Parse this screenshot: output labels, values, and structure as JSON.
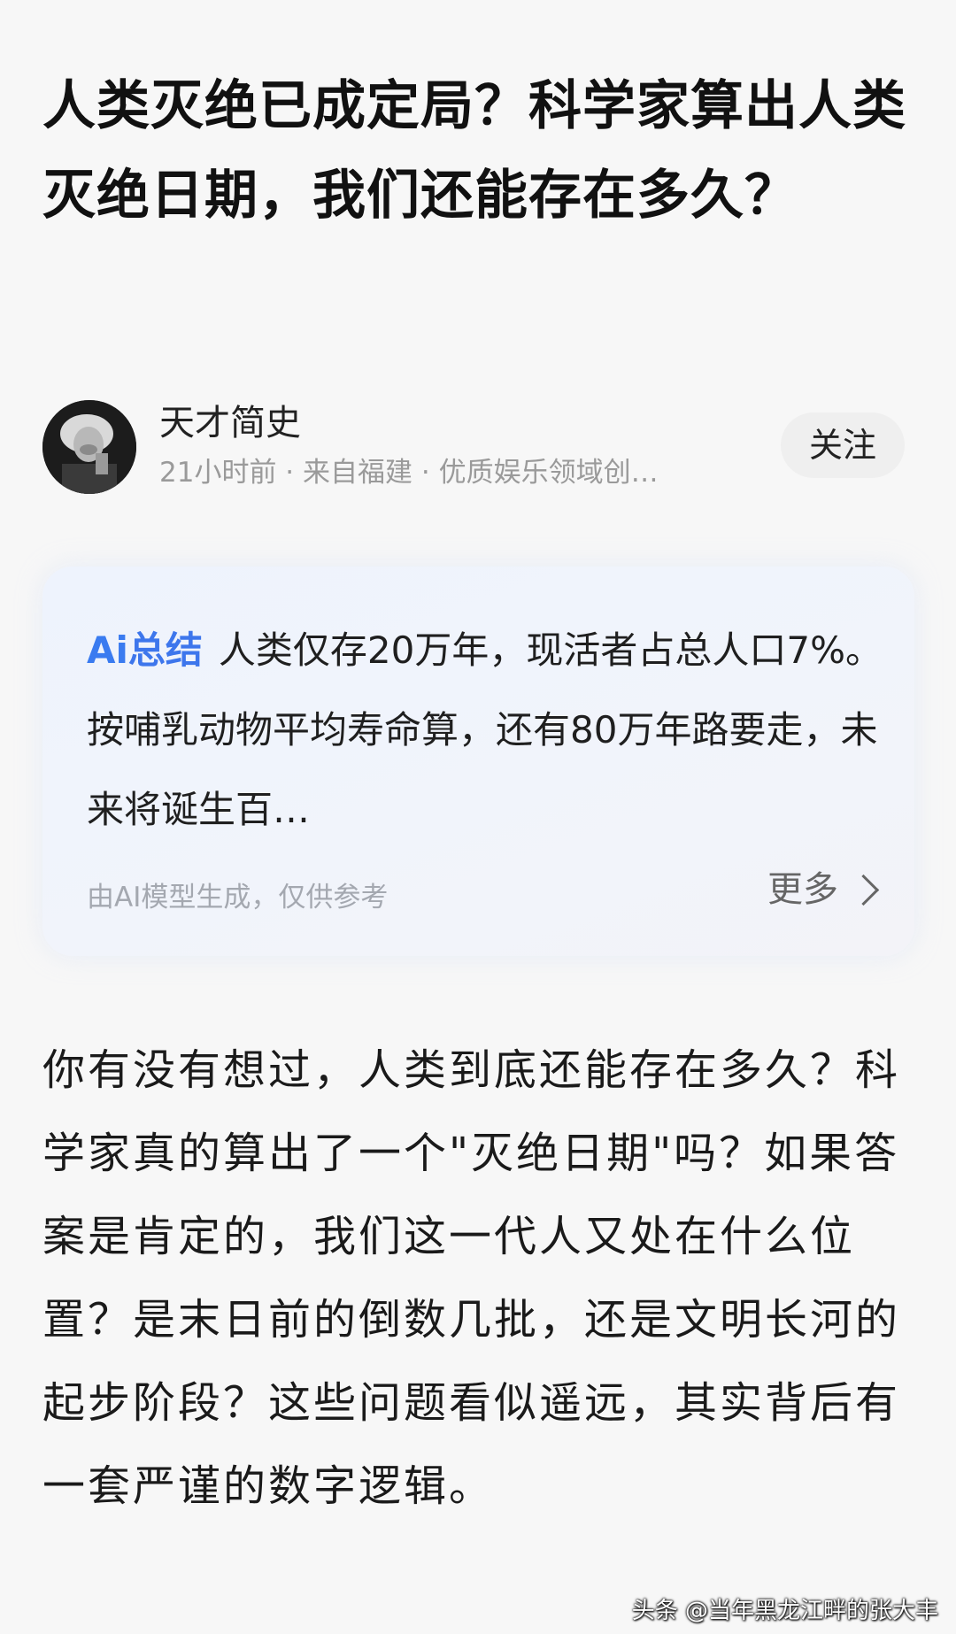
{
  "article": {
    "title": "人类灭绝已成定局？科学家算出人类灭绝日期，我们还能存在多久？"
  },
  "author": {
    "name": "天才简史",
    "meta": "21小时前 · 来自福建 · 优质娱乐领域创…",
    "follow_label": "关注",
    "avatar_icon": "portrait-avatar-icon"
  },
  "ai_summary": {
    "badge_a": "Ai",
    "badge_label": "总结",
    "text": "人类仅存20万年，现活者占总人口7%。按哺乳动物平均寿命算，还有80万年路要走，未来将诞生百…",
    "disclaimer": "由AI模型生成，仅供参考",
    "more_label": "更多",
    "badge_color": "#3d76ec"
  },
  "body": {
    "paragraph": "你有没有想过，人类到底还能存在多久？科学家真的算出了一个\"灭绝日期\"吗？如果答案是肯定的，我们这一代人又处在什么位置？是末日前的倒数几批，还是文明长河的起步阶段？这些问题看似遥远，其实背后有一套严谨的数字逻辑。"
  },
  "watermark": {
    "text": "头条 @当年黑龙江畔的张大丰"
  }
}
